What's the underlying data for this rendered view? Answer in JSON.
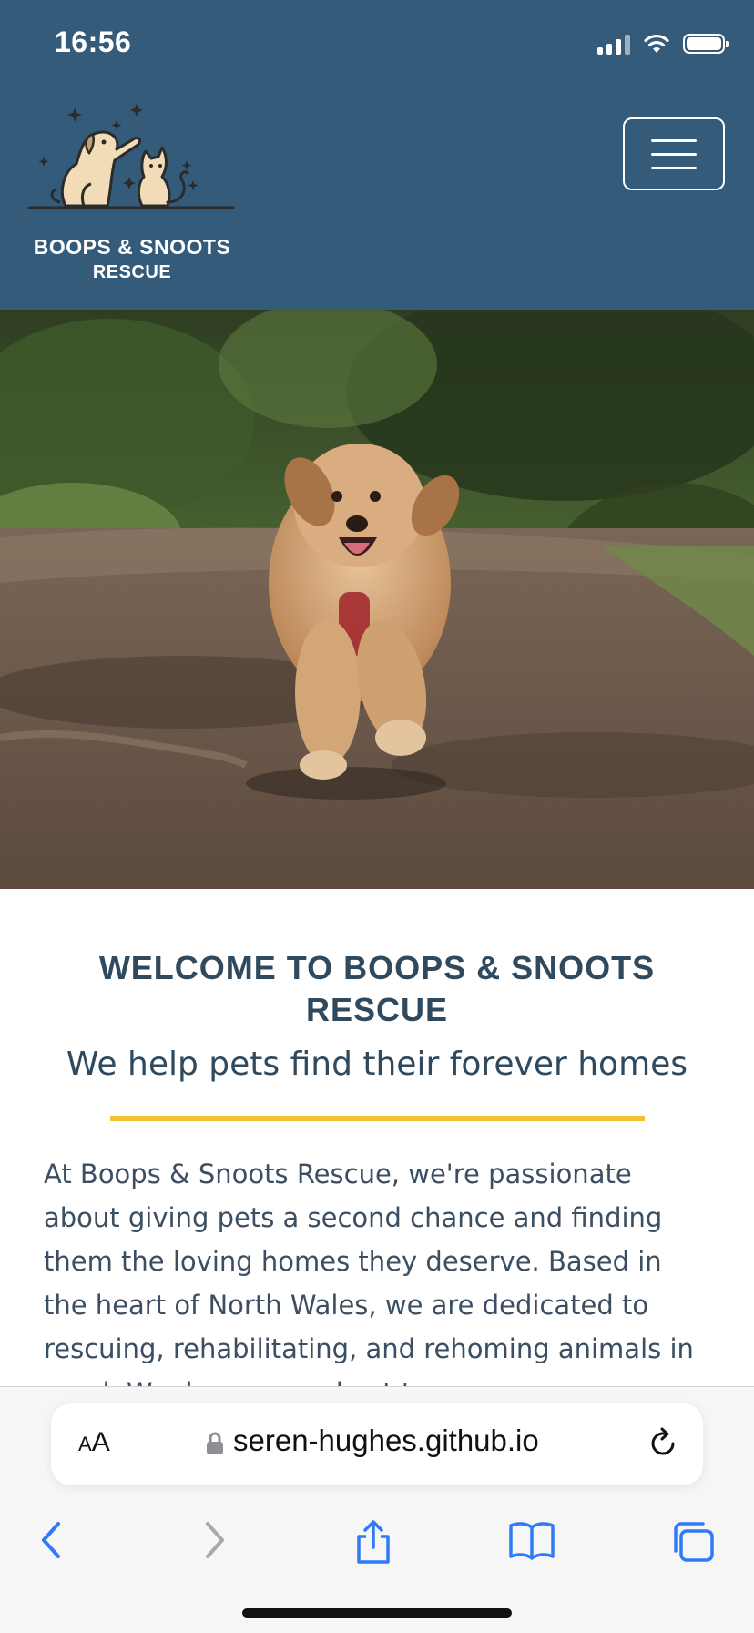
{
  "status_bar": {
    "time": "16:56"
  },
  "header": {
    "brand_name": "BOOPS & SNOOTS",
    "brand_sub": "RESCUE",
    "menu_icon": "hamburger-menu-icon"
  },
  "hero": {
    "alt": "Fluffy dog running along a forest path"
  },
  "welcome": {
    "title": "WELCOME TO BOOPS & SNOOTS RESCUE",
    "subtitle": "We help pets find their forever homes",
    "intro": "At Boops & Snoots Rescue, we're passionate about giving pets a second chance and finding them the loving homes they deserve. Based in the heart of North Wales, we are dedicated to rescuing, rehabilitating, and rehoming animals in need. We do our very best to"
  },
  "browser": {
    "text_size_label_small": "A",
    "text_size_label_big": "A",
    "url": "seren-hughes.github.io",
    "icons": [
      "lock-icon",
      "reload-icon",
      "back-icon",
      "forward-icon",
      "share-icon",
      "bookmarks-icon",
      "tabs-icon"
    ]
  },
  "colors": {
    "header_bg": "#345b79",
    "heading_text": "#2f4a5e",
    "accent_divider": "#efc233",
    "safari_blue": "#2f7bf5"
  }
}
